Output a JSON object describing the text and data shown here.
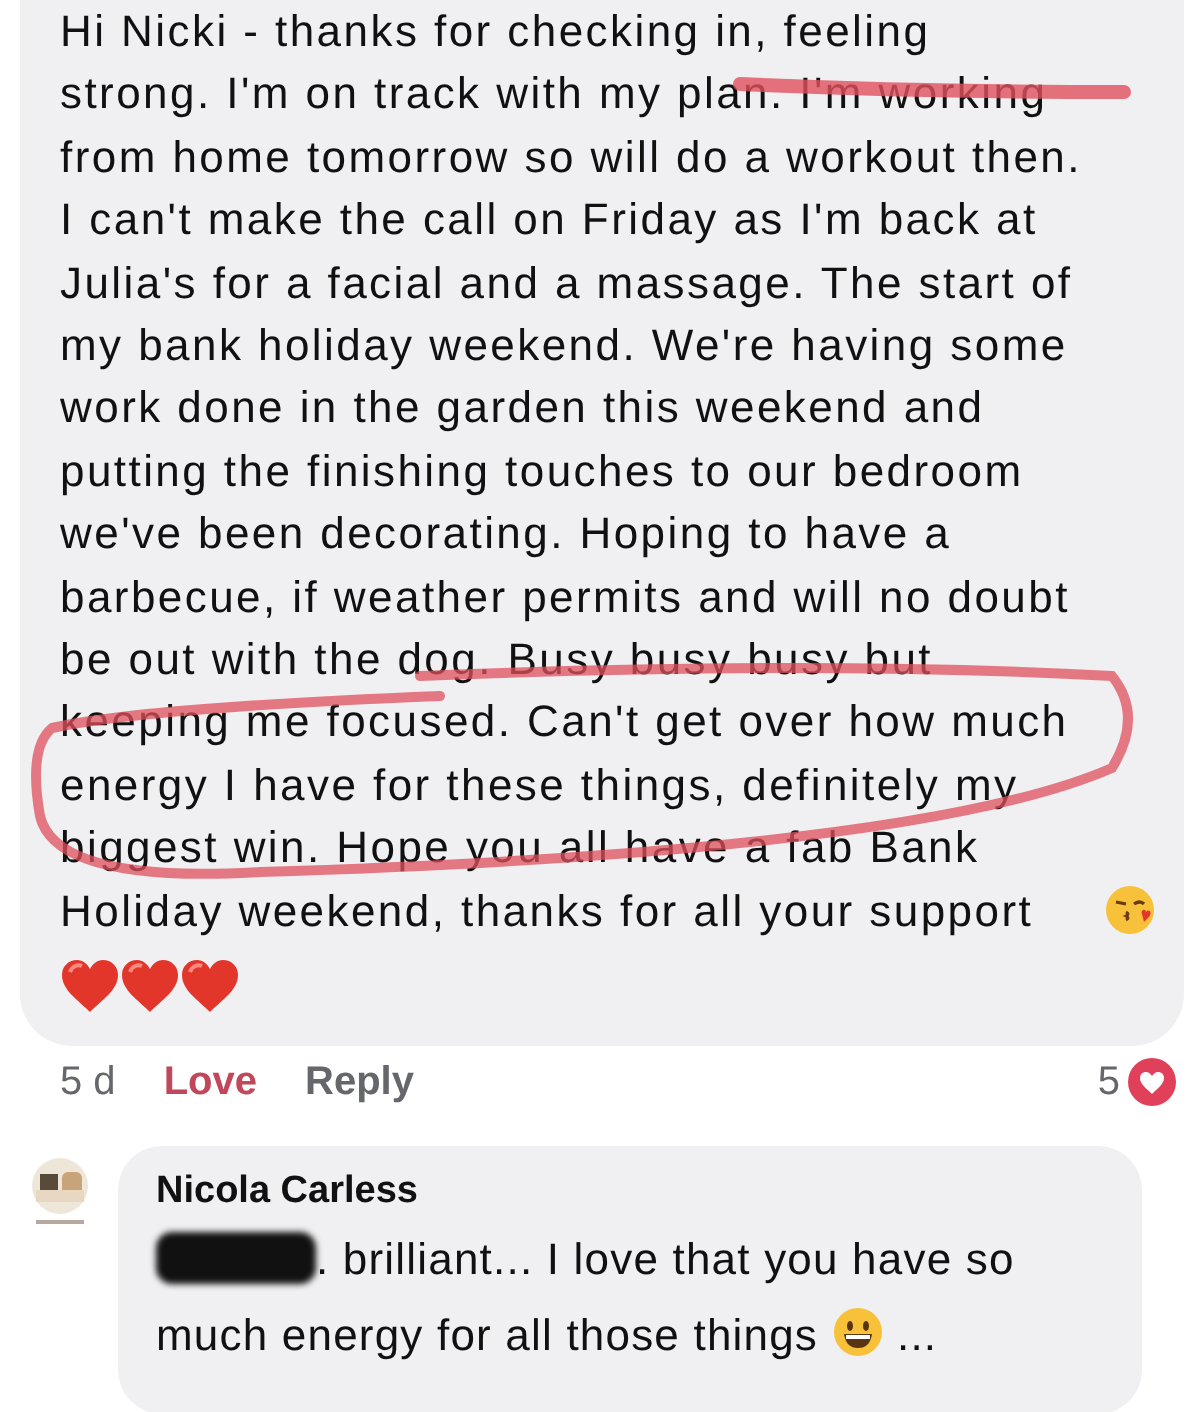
{
  "comment": {
    "text": "Hi Nicki - thanks for checking in, feeling strong. I'm on track with my plan. I'm working from home tomorrow so will do a workout then. I can't make the call on Friday as I'm back at Julia's for a facial and a massage. The start of my bank holiday weekend. We're having some work done in the garden this weekend and putting the finishing touches to our bedroom we've been decorating. Hoping to have a barbecue, if weather permits and will no doubt be out with the dog. Busy busy busy but keeping me focused. Can't get over how much energy I have for these things, definitely my biggest win. Hope you all have a fab Bank Holiday weekend, thanks for all your support",
    "emoji_line": [
      {
        "kind": "heart"
      },
      {
        "kind": "heart"
      },
      {
        "kind": "heart"
      }
    ],
    "underline_mark": true,
    "loop_mark": true,
    "time": "5 d",
    "love": {
      "label": "Love",
      "selected": true
    },
    "reply": "Reply",
    "reaction_count": "5"
  },
  "reply": {
    "author": "Nicola Carless",
    "text_lines": [
      ". brilliant... I love that you have so",
      "much energy for all those things"
    ],
    "trailing": "..."
  }
}
